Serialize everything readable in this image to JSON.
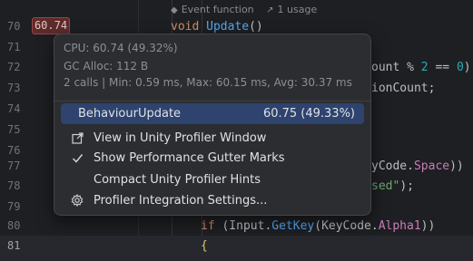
{
  "editor": {
    "lens": {
      "kind": "Event function",
      "usages": "1 usage"
    },
    "hint_value": "60.74",
    "lines": [
      {
        "num": "70"
      },
      {
        "num": "71"
      },
      {
        "num": "72",
        "frag_a": "ount % ",
        "frag_num": "2",
        "frag_b": " == ",
        "frag_num2": "0",
        "frag_c": ")"
      },
      {
        "num": "73",
        "frag_a": "ionCount;"
      },
      {
        "num": "74"
      },
      {
        "num": "75"
      },
      {
        "num": "76"
      },
      {
        "num": "77",
        "frag_a": "yCode.",
        "frag_enum": "Space",
        "frag_b": "))"
      },
      {
        "num": "78",
        "frag_str": "sed\"",
        "frag_b": ");"
      },
      {
        "num": "79"
      },
      {
        "num": "80"
      },
      {
        "num": "81"
      }
    ],
    "line70": {
      "kw": "void",
      "fn": "Update",
      "rest": "()"
    },
    "line80": {
      "kw": "if",
      "p1": " (Input.",
      "fn": "GetKey",
      "p2": "(KeyCode.",
      "enum": "Alpha1",
      "p3": "))"
    },
    "line81": {
      "brace": "{"
    }
  },
  "popup": {
    "cpu": "CPU: 60.74 (49.32%)",
    "gc_alloc": "GC Alloc: 112 B",
    "calls": "2 calls | Min: 0.59 ms, Max: 60.15 ms, Avg: 30.37 ms",
    "selected": {
      "label": "BehaviourUpdate",
      "value": "60.75 (49.33%)"
    },
    "items": [
      {
        "label": "View in Unity Profiler Window",
        "icon": "external-link-icon"
      },
      {
        "label": "Show Performance Gutter Marks",
        "icon": "checkmark-icon",
        "checked": true
      },
      {
        "label": "Compact Unity Profiler Hints",
        "icon": ""
      },
      {
        "label": "Profiler Integration Settings...",
        "icon": "gear-icon"
      }
    ]
  },
  "colors": {
    "background": "#1e1f22",
    "popup_bg": "#2b2d30",
    "selection": "#2e436e",
    "hint_bg": "#5e2b2b",
    "keyword": "#cf8e6d",
    "function": "#56a8f5",
    "string": "#6aab73",
    "enum": "#c77dbb"
  }
}
